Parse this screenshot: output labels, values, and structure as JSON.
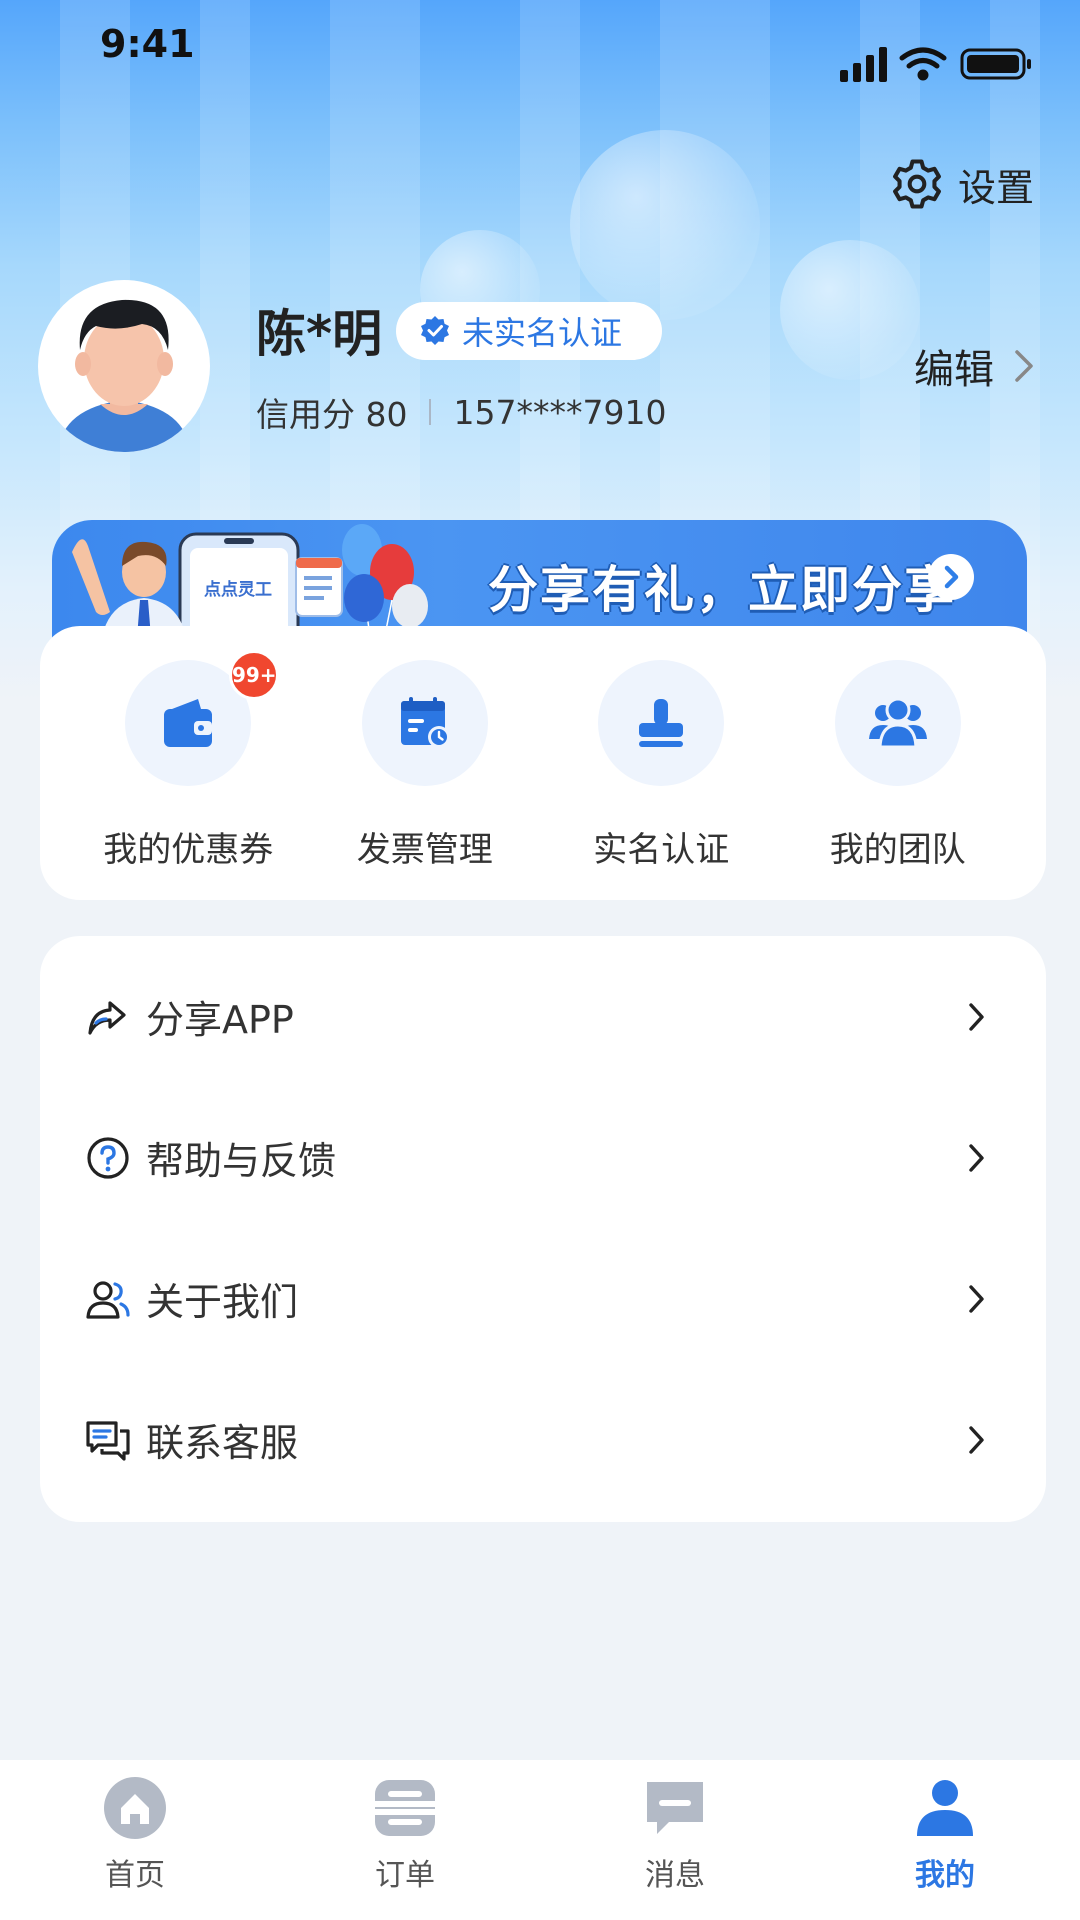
{
  "status_bar": {
    "time": "9:41"
  },
  "settings": {
    "label": "设置",
    "icon": "gear-icon"
  },
  "profile": {
    "name": "陈*明",
    "verify_status": "未实名认证",
    "credit": "信用分 80",
    "phone": "157****7910",
    "edit_label": "编辑"
  },
  "banner": {
    "text": "分享有礼，立即分享",
    "phone_screen_text": "点点灵工"
  },
  "tools": [
    {
      "label": "我的优惠券",
      "icon": "wallet-icon",
      "badge": "99+"
    },
    {
      "label": "发票管理",
      "icon": "invoice-calendar-icon"
    },
    {
      "label": "实名认证",
      "icon": "stamp-icon"
    },
    {
      "label": "我的团队",
      "icon": "team-icon"
    }
  ],
  "menu": [
    {
      "label": "分享APP",
      "icon": "share-icon"
    },
    {
      "label": "帮助与反馈",
      "icon": "help-icon"
    },
    {
      "label": "关于我们",
      "icon": "people-icon"
    },
    {
      "label": "联系客服",
      "icon": "chat-icon"
    }
  ],
  "tabbar": [
    {
      "label": "首页",
      "icon": "home-icon",
      "active": false
    },
    {
      "label": "订单",
      "icon": "order-icon",
      "active": false
    },
    {
      "label": "消息",
      "icon": "message-icon",
      "active": false
    },
    {
      "label": "我的",
      "icon": "profile-icon",
      "active": true
    }
  ],
  "colors": {
    "primary": "#2c77e3",
    "badge": "#f0472f",
    "page_bg": "#eff3f8"
  }
}
